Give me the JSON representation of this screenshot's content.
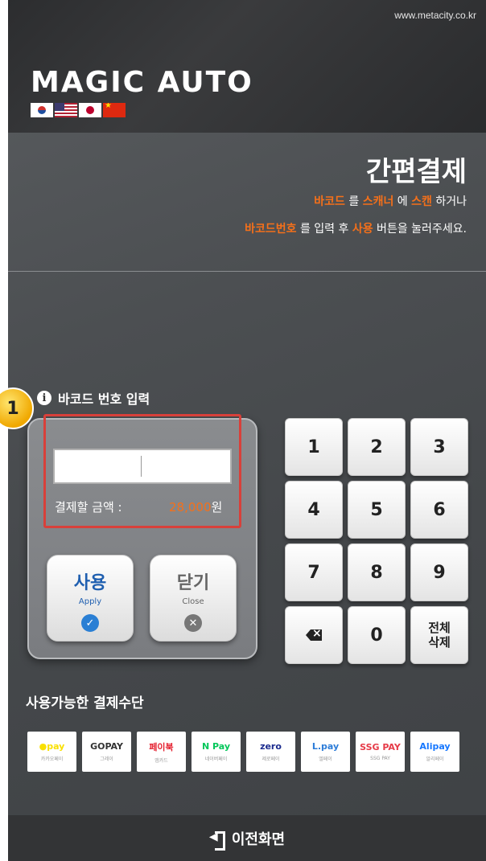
{
  "header": {
    "url": "www.metacity.co.kr",
    "logo": "MAGIC AUTO",
    "flags": [
      "flag-kr-icon",
      "flag-us-icon",
      "flag-jp-icon",
      "flag-cn-icon"
    ]
  },
  "title": "간편결제",
  "instructions": {
    "line1": [
      {
        "text": "바코드",
        "hl": true
      },
      {
        "text": " 를 ",
        "hl": false
      },
      {
        "text": "스캐너",
        "hl": true
      },
      {
        "text": " 에 ",
        "hl": false
      },
      {
        "text": "스캔",
        "hl": true
      },
      {
        "text": " 하거나",
        "hl": false
      }
    ],
    "line2": [
      {
        "text": "바코드번호",
        "hl": true
      },
      {
        "text": " 를 입력 후 ",
        "hl": false
      },
      {
        "text": "사용",
        "hl": true
      },
      {
        "text": " 버튼을 눌러주세요.",
        "hl": false
      }
    ]
  },
  "badge": "1",
  "barcode": {
    "label": "바코드 번호 입력",
    "value": "",
    "amount_label": "결제할 금액 :",
    "amount_value": "28,000",
    "amount_unit": "원"
  },
  "actions": {
    "apply": {
      "main": "사용",
      "sub": "Apply"
    },
    "close": {
      "main": "닫기",
      "sub": "Close"
    }
  },
  "keypad": [
    "1",
    "2",
    "3",
    "4",
    "5",
    "6",
    "7",
    "8",
    "9",
    "backspace",
    "0",
    "전체\n삭제"
  ],
  "payments": {
    "title": "사용가능한 결제수단",
    "methods": [
      {
        "logo": "●pay",
        "sub": "카카오페이",
        "color": "#f9e000"
      },
      {
        "logo": "GOPAY",
        "sub": "그레이",
        "color": "#333333"
      },
      {
        "logo": "페이북",
        "sub": "앱카드",
        "color": "#e5202f"
      },
      {
        "logo": "N Pay",
        "sub": "네이버페이",
        "color": "#03c75a"
      },
      {
        "logo": "zero",
        "sub": "제로페이",
        "color": "#1c2c8f"
      },
      {
        "logo": "L.pay",
        "sub": "엘페이",
        "color": "#2c7cd8"
      },
      {
        "logo": "SSG PAY",
        "sub": "SSG PAY",
        "color": "#e63b48"
      },
      {
        "logo": "Alipay",
        "sub": "알리페이",
        "color": "#1677ff"
      }
    ]
  },
  "footer": {
    "label": "이전화면"
  }
}
